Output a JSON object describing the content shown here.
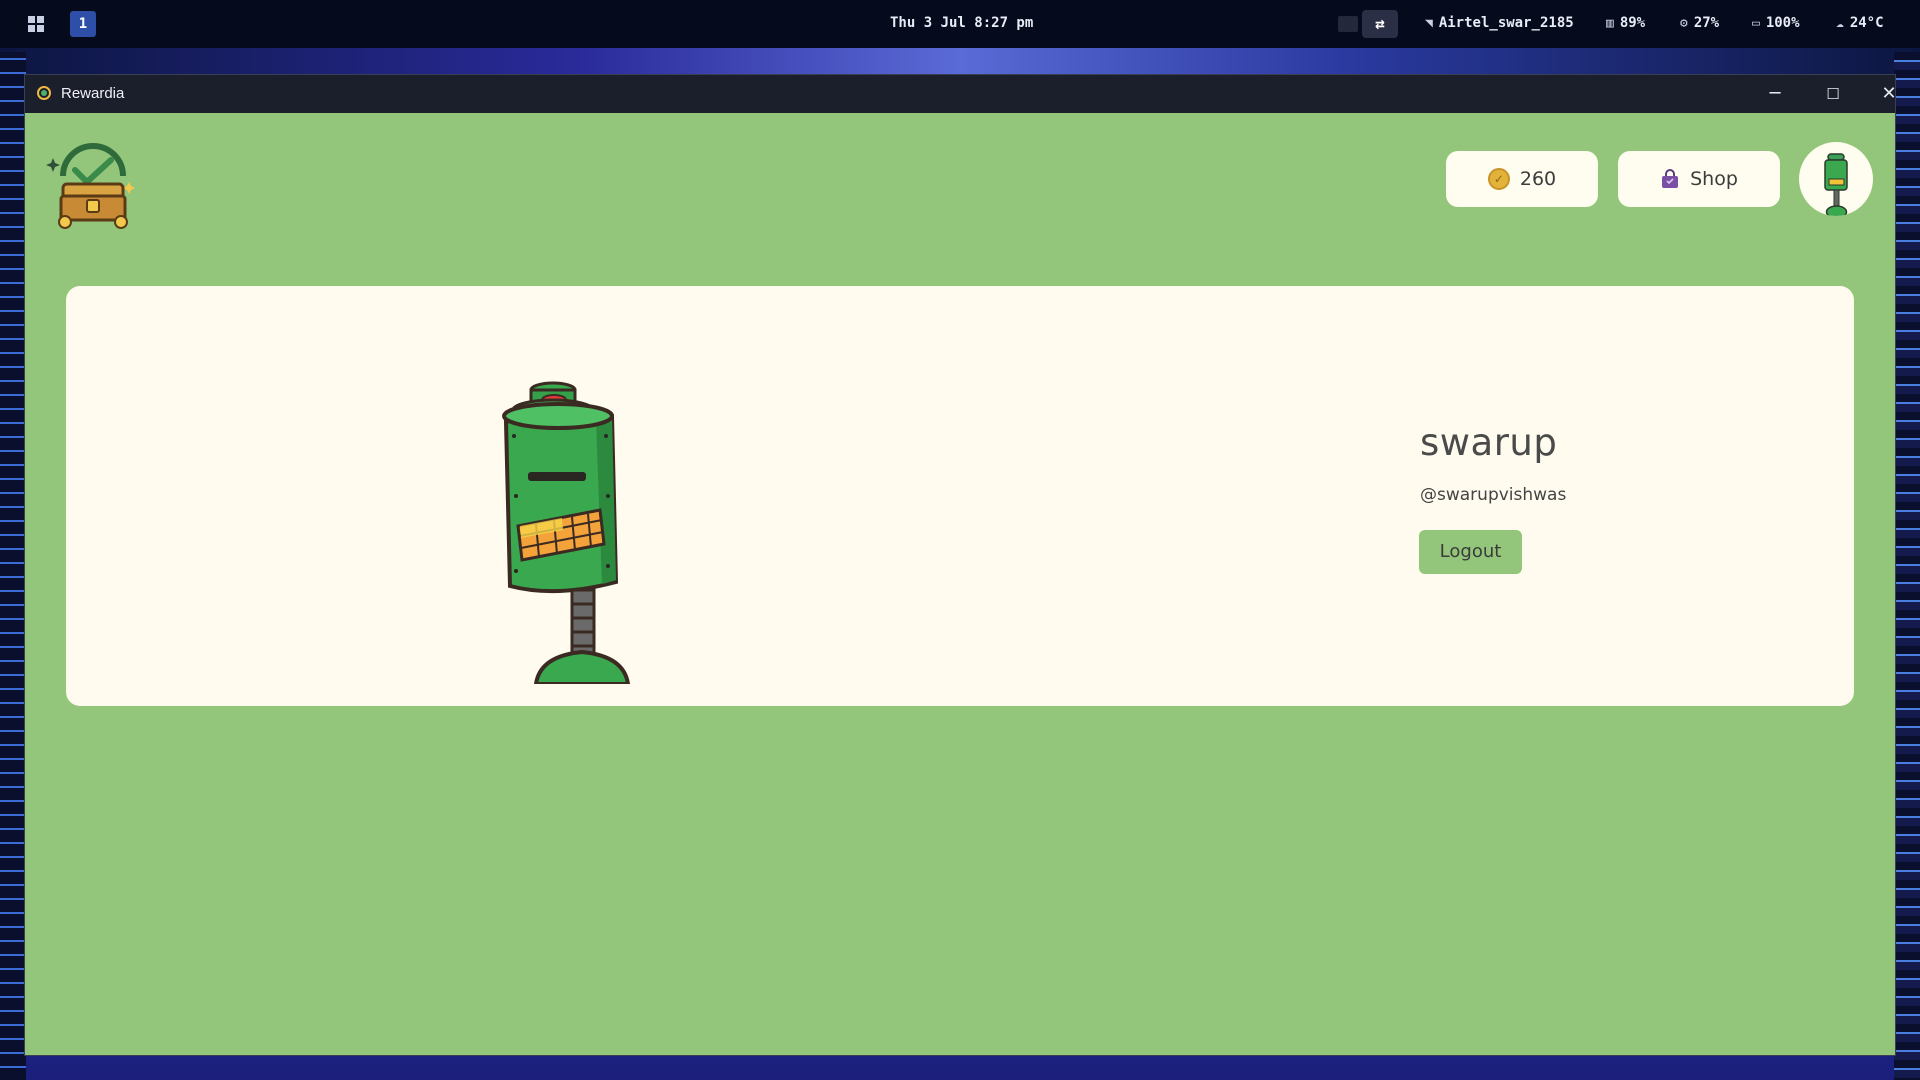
{
  "taskbar": {
    "workspace": "1",
    "clock": "Thu 3 Jul 8:27 pm",
    "wifi_name": "Airtel_swar_2185",
    "memory": "89%",
    "cpu": "27%",
    "battery": "100%",
    "temperature": "24°C"
  },
  "window": {
    "title": "Rewardia",
    "minimize": "─",
    "maximize": "☐",
    "close": "✕"
  },
  "header": {
    "coins": "260",
    "shop_label": "Shop"
  },
  "profile": {
    "name": "swarup",
    "handle": "@swarupvishwas",
    "logout_label": "Logout"
  },
  "colors": {
    "app_background": "#93c67b",
    "card_background": "#fffbef",
    "pill_background": "#fffdf0",
    "coin": "#e3b23a",
    "shop_bag": "#7a4fa6"
  },
  "icons": [
    "windows-logo-icon",
    "wifi-icon",
    "memory-icon",
    "cpu-icon",
    "battery-icon",
    "temperature-icon",
    "treasure-chest-logo",
    "coin-icon",
    "shopping-bag-icon",
    "robot-avatar"
  ]
}
